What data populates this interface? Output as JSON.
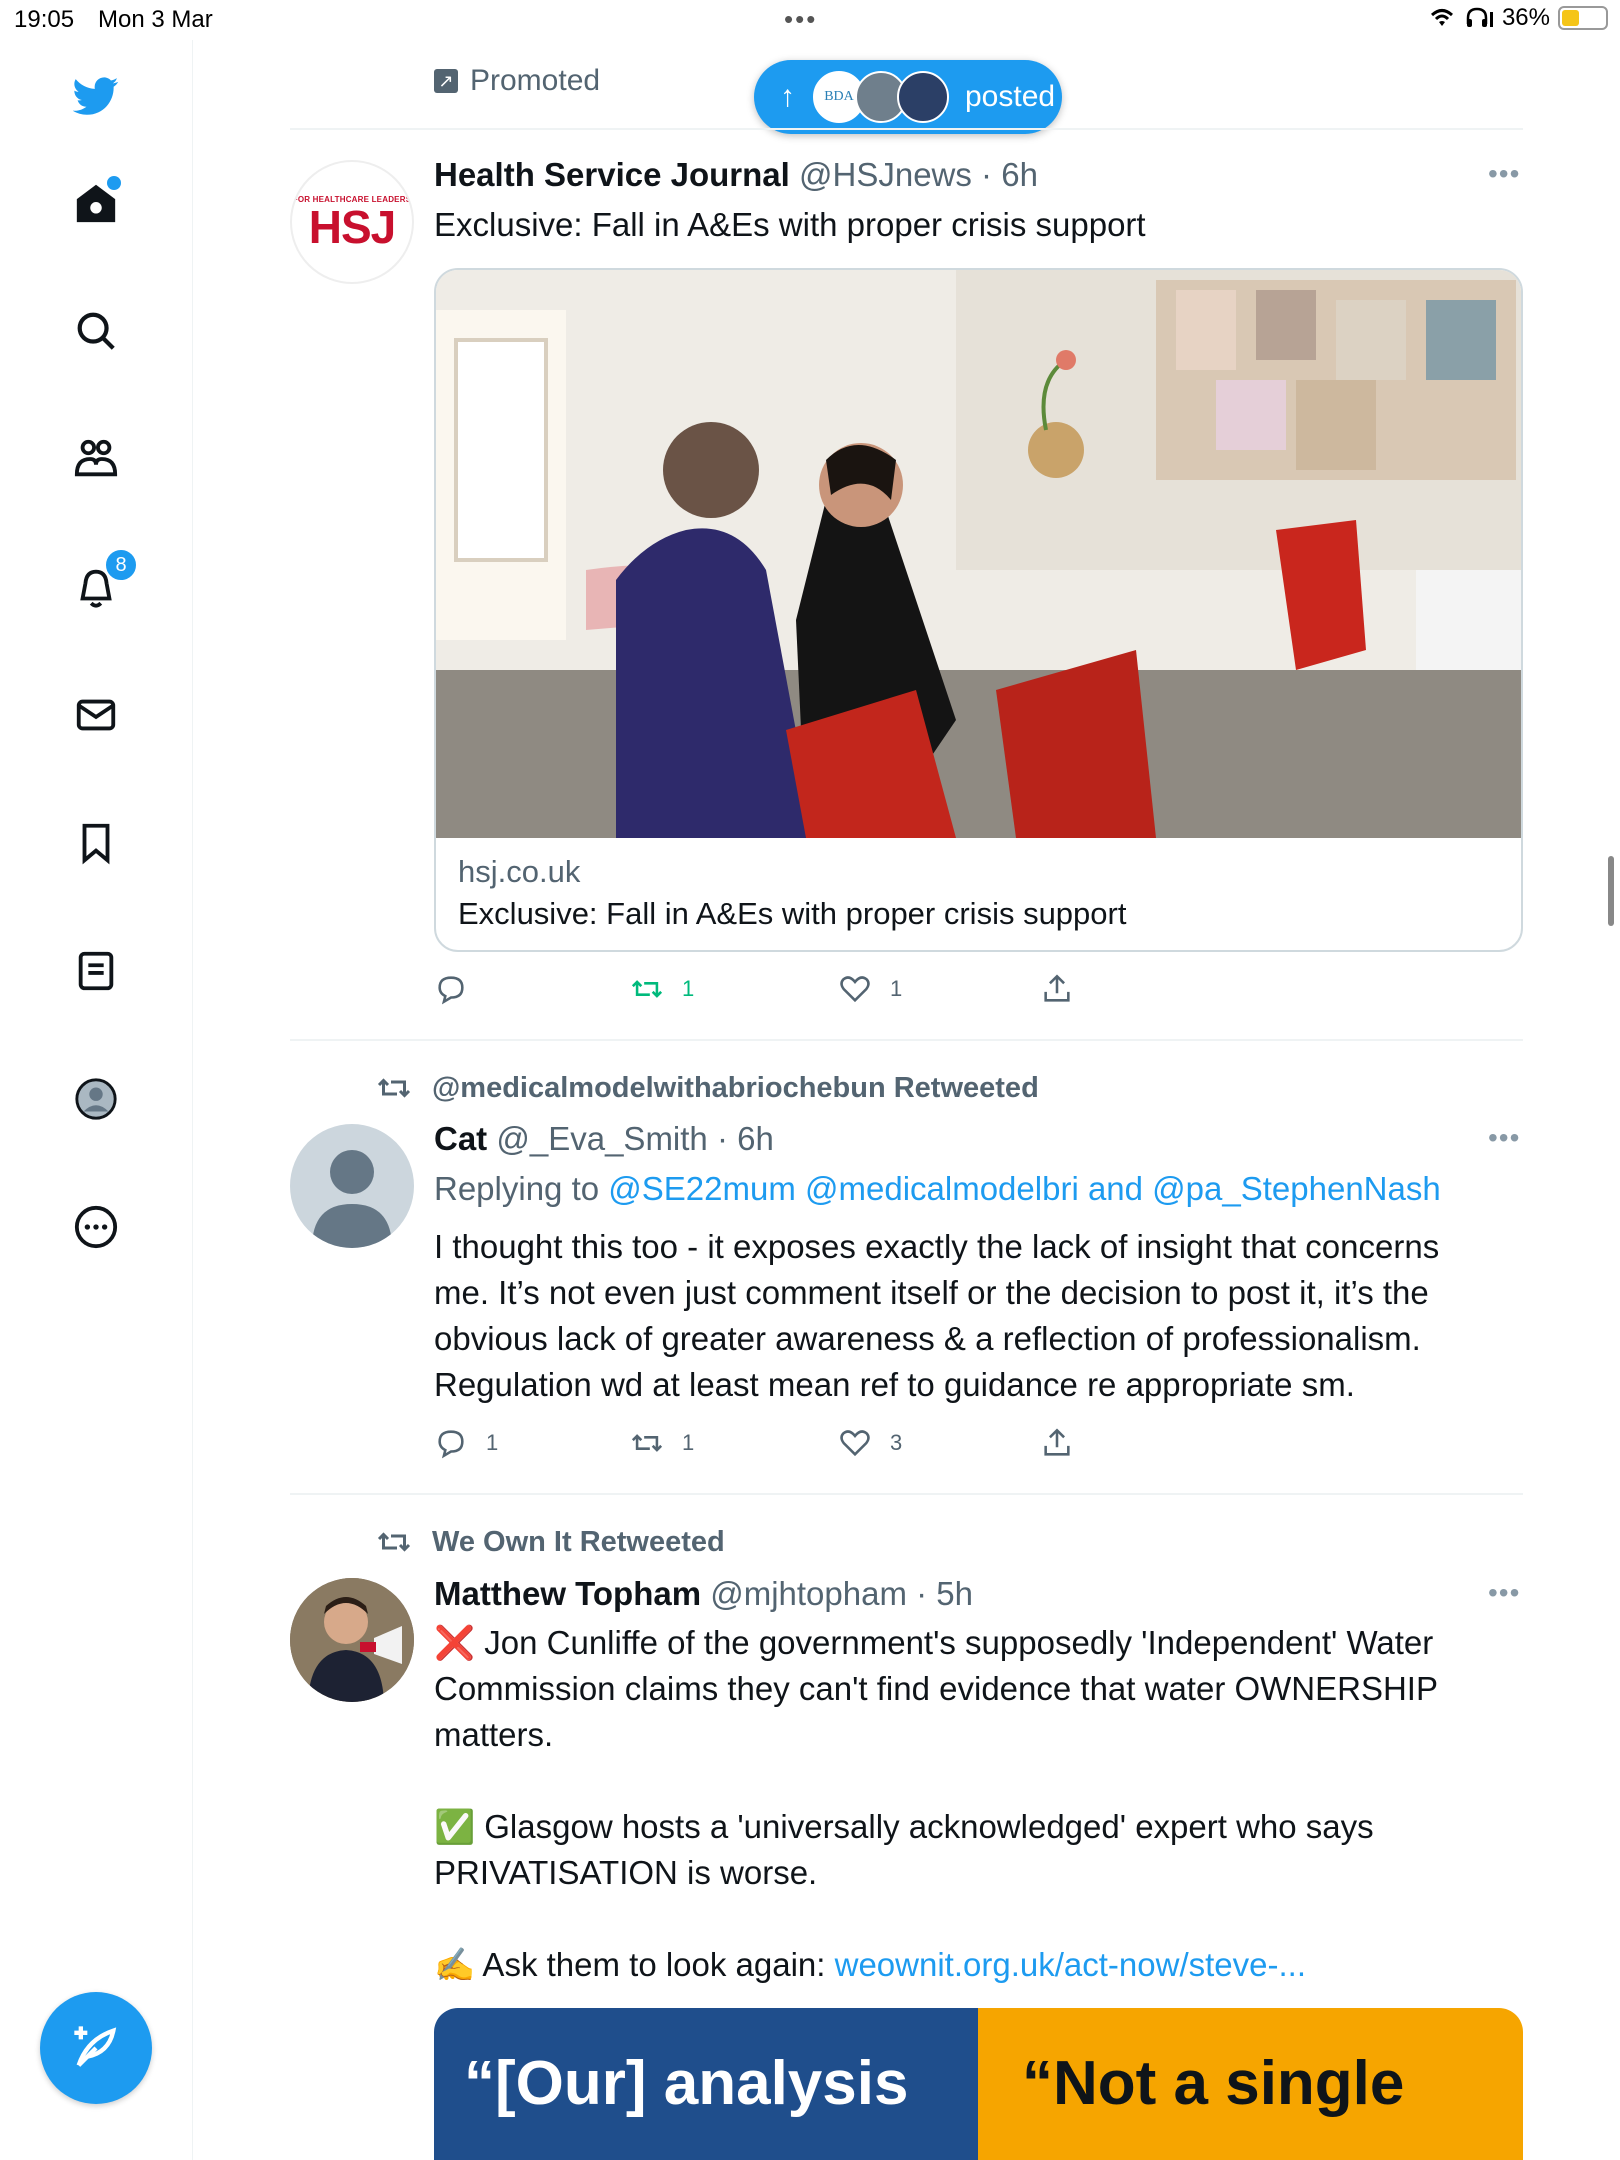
{
  "status_bar": {
    "time": "19:05",
    "date": "Mon 3 Mar",
    "battery": "36%",
    "battery_level": 0.36
  },
  "sidebar": {
    "notifications_count": "8",
    "items": [
      "home-icon",
      "search-icon",
      "communities-icon",
      "notifications-icon",
      "messages-icon",
      "bookmarks-icon",
      "lists-icon",
      "profile-icon",
      "more-icon"
    ]
  },
  "colors": {
    "accent": "#1d9bf0",
    "retweet": "#00ba7c",
    "secondary_text": "#536471"
  },
  "feed": {
    "promoted_label": "Promoted",
    "new_posts_pill": {
      "avatar1_text": "BDA",
      "label": "posted"
    },
    "tweets": [
      {
        "name": "Health Service Journal",
        "handle": "@HSJnews",
        "time": "6h",
        "avatar_text_small": "FOR HEALTHCARE LEADERS",
        "avatar_text_big": "HSJ",
        "text": "Exclusive: Fall in A&Es with proper crisis support",
        "card": {
          "domain": "hsj.co.uk",
          "title": "Exclusive: Fall in A&Es with proper crisis support"
        },
        "actions": {
          "replies": "",
          "retweets": "1",
          "likes": "1"
        }
      },
      {
        "retweeted_by": "@medicalmodelwithabriochebun Retweeted",
        "name": "Cat",
        "handle": "@_Eva_Smith",
        "time": "6h",
        "replying_prefix": "Replying to",
        "replying_to": "@SE22mum @medicalmodelbri and @pa_StephenNash",
        "lines": [
          "I thought this too - it exposes exactly the lack of insight that concerns",
          "me. It’s not even just comment itself or the decision to post it, it’s the",
          "obvious lack of greater awareness & a reflection of professionalism.",
          "Regulation wd at least mean ref to guidance re appropriate sm."
        ],
        "actions": {
          "replies": "1",
          "retweets": "1",
          "likes": "3"
        }
      },
      {
        "retweeted_by": "We Own It Retweeted",
        "name": "Matthew Topham",
        "handle": "@mjhtopham",
        "time": "5h",
        "lines": [
          "❌ Jon Cunliffe of the government's supposedly 'Independent' Water",
          "Commission claims they can't find evidence that water OWNERSHIP",
          "matters."
        ],
        "lines2": [
          "✅ Glasgow hosts a 'universally acknowledged' expert who says",
          "PRIVATISATION is worse."
        ],
        "ask_prefix": "✍️ Ask them to look again: ",
        "ask_link": "weownit.org.uk/act-now/steve-...",
        "image_left": "“[Our] analysis",
        "image_right": "“Not a single"
      }
    ]
  }
}
